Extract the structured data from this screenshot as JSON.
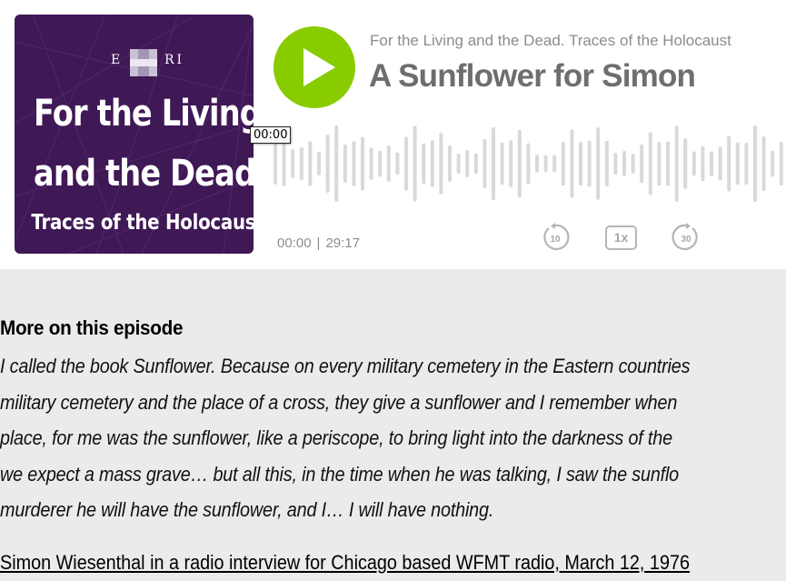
{
  "player": {
    "cover": {
      "logo_left": "E",
      "logo_right": "RI",
      "line1": "For the Living",
      "line2": "and the Dead",
      "line3": "Traces of the Holocaust",
      "bg_color": "#3f1856"
    },
    "play_icon": "play-icon",
    "accent_color": "#88cc00",
    "series_title": "For the Living and the Dead. Traces of the Holocaust",
    "episode_title": "A Sunflower for Simon",
    "hover_time": "00:00",
    "current_time": "00:00",
    "separator": "|",
    "duration": "29:17",
    "progress": 0,
    "controls": {
      "rewind_label": "10",
      "speed_label": "1x",
      "forward_label": "30"
    }
  },
  "more": {
    "heading": "More on this episode",
    "quote_lines": [
      "I called the book Sunflower. Because on every military cemetery in the Eastern countries",
      "military cemetery and the place of a cross, they give a sunflower and I remember when",
      "place, for me was the sunflower, like a periscope, to bring light into the darkness of the",
      "we expect a mass grave… but all this, in the time when he was talking, I saw the sunflo",
      "murderer he will have the sunflower, and I… I will have nothing."
    ],
    "attribution": "Simon Wiesenthal in a radio interview for Chicago based WFMT radio, March 12, 1976"
  }
}
